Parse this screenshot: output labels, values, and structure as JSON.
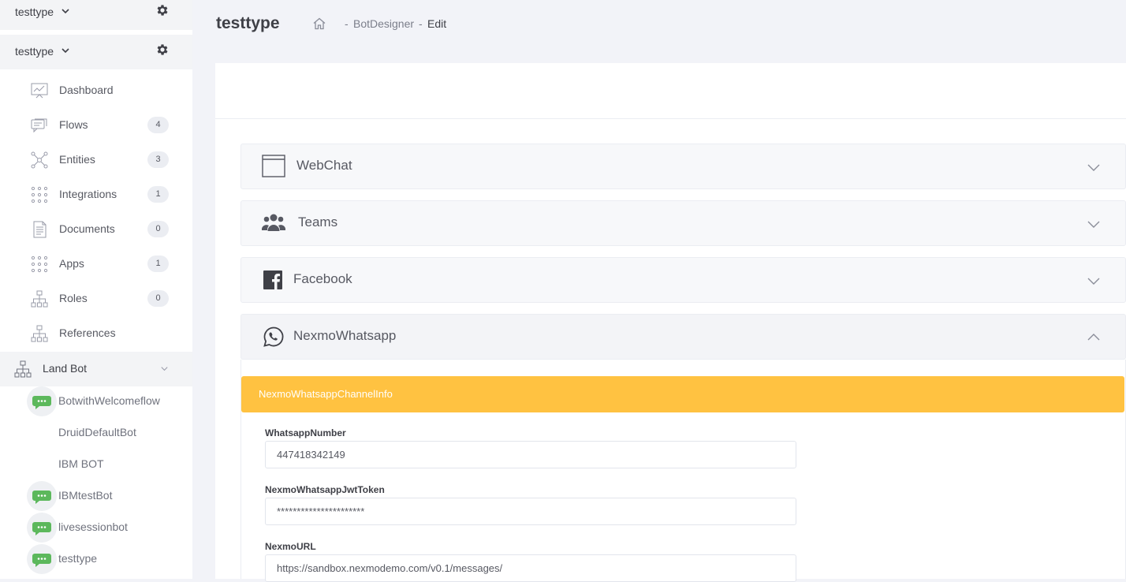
{
  "sidebar": {
    "header_top": {
      "title": "testtype"
    },
    "header": {
      "title": "testtype"
    },
    "items": [
      {
        "label": "Dashboard",
        "icon": "dashboard-icon"
      },
      {
        "label": "Flows",
        "badge": "4",
        "icon": "flows-icon"
      },
      {
        "label": "Entities",
        "badge": "3",
        "icon": "entities-icon"
      },
      {
        "label": "Integrations",
        "badge": "1",
        "icon": "integrations-icon"
      },
      {
        "label": "Documents",
        "badge": "0",
        "icon": "documents-icon"
      },
      {
        "label": "Apps",
        "badge": "1",
        "icon": "apps-icon"
      },
      {
        "label": "Roles",
        "badge": "0",
        "icon": "roles-icon"
      },
      {
        "label": "References",
        "icon": "references-icon"
      }
    ],
    "group": {
      "label": "Land Bot"
    },
    "bots": [
      {
        "label": "BotwithWelcomeflow",
        "avatar": true
      },
      {
        "label": "DruidDefaultBot",
        "avatar": false
      },
      {
        "label": "IBM BOT",
        "avatar": false
      },
      {
        "label": "IBMtestBot",
        "avatar": true
      },
      {
        "label": "livesessionbot",
        "avatar": true
      },
      {
        "label": "testtype",
        "avatar": true
      }
    ]
  },
  "header": {
    "title": "testtype",
    "breadcrumb": {
      "sep": "-",
      "item1": "BotDesigner",
      "item2": "Edit"
    }
  },
  "channels": [
    {
      "label": "WebChat",
      "icon": "window-icon",
      "expanded": false
    },
    {
      "label": "Teams",
      "icon": "users-icon",
      "expanded": false
    },
    {
      "label": "Facebook",
      "icon": "facebook-icon",
      "expanded": false
    },
    {
      "label": "NexmoWhatsapp",
      "icon": "whatsapp-icon",
      "expanded": true
    }
  ],
  "nexmo": {
    "section_title": "NexmoWhatsappChannelInfo",
    "fields": [
      {
        "label": "WhatsappNumber",
        "value": "447418342149"
      },
      {
        "label": "NexmoWhatsappJwtToken",
        "value": "**********************"
      },
      {
        "label": "NexmoURL",
        "value": "https://sandbox.nexmodemo.com/v0.1/messages/"
      }
    ]
  },
  "colors": {
    "accent": "#ffc241",
    "bot_avatar": "#5cb85c",
    "sidebar_active_bg": "#f3f4f6"
  }
}
